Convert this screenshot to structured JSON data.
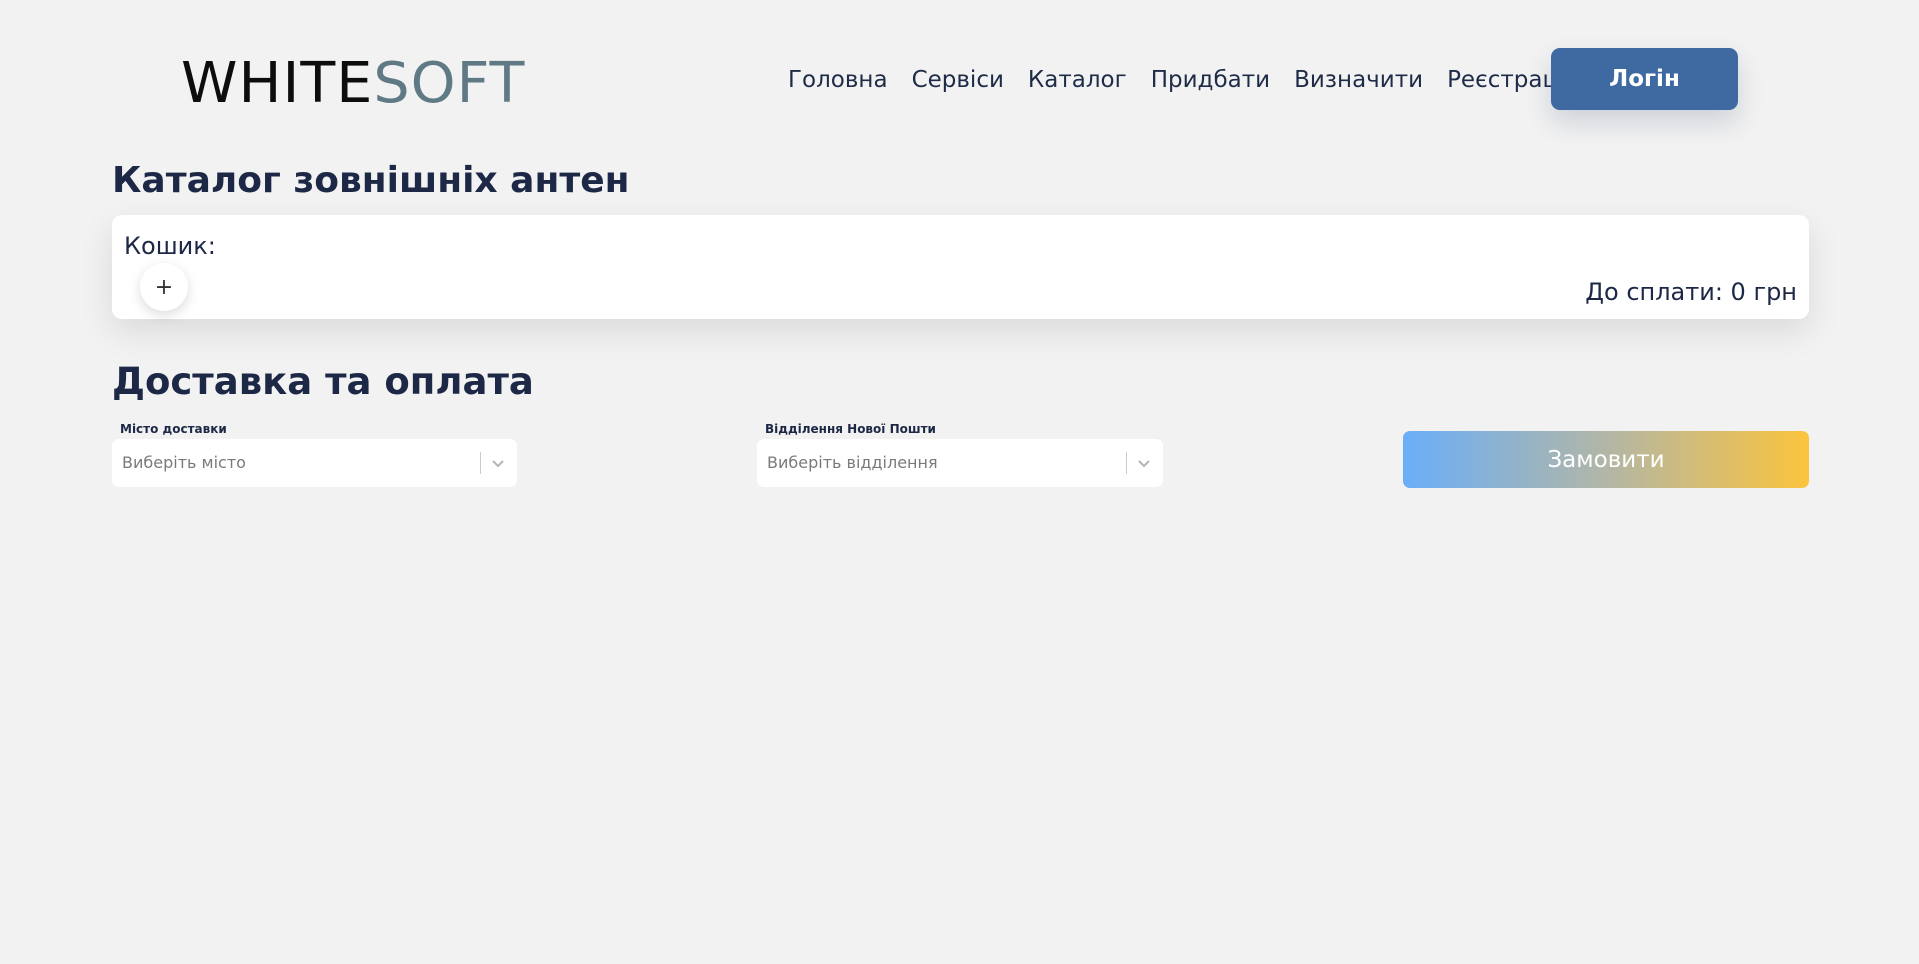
{
  "header": {
    "logo_part1": "WHITE",
    "logo_part2": "SOFT",
    "nav": [
      "Головна",
      "Сервіси",
      "Каталог",
      "Придбати",
      "Визначити",
      "Реєстрація"
    ],
    "login_label": "Логін"
  },
  "page_title": "Каталог зовнішніх антен",
  "cart": {
    "label": "Кошик:",
    "add_symbol": "+",
    "total": "До сплати: 0 грн"
  },
  "delivery": {
    "title": "Доставка та оплата",
    "city_label": "Місто доставки",
    "city_placeholder": "Виберіть місто",
    "branch_label": "Відділення Нової Пошти",
    "branch_placeholder": "Виберіть відділення",
    "order_label": "Замовити"
  },
  "colors": {
    "accent": "#3f6aa1",
    "logo_secondary": "#5f7a84",
    "gradient_start": "#6aaef9",
    "gradient_end": "#fbc43d"
  },
  "icons": [
    "plus-icon",
    "chevron-down-icon"
  ]
}
